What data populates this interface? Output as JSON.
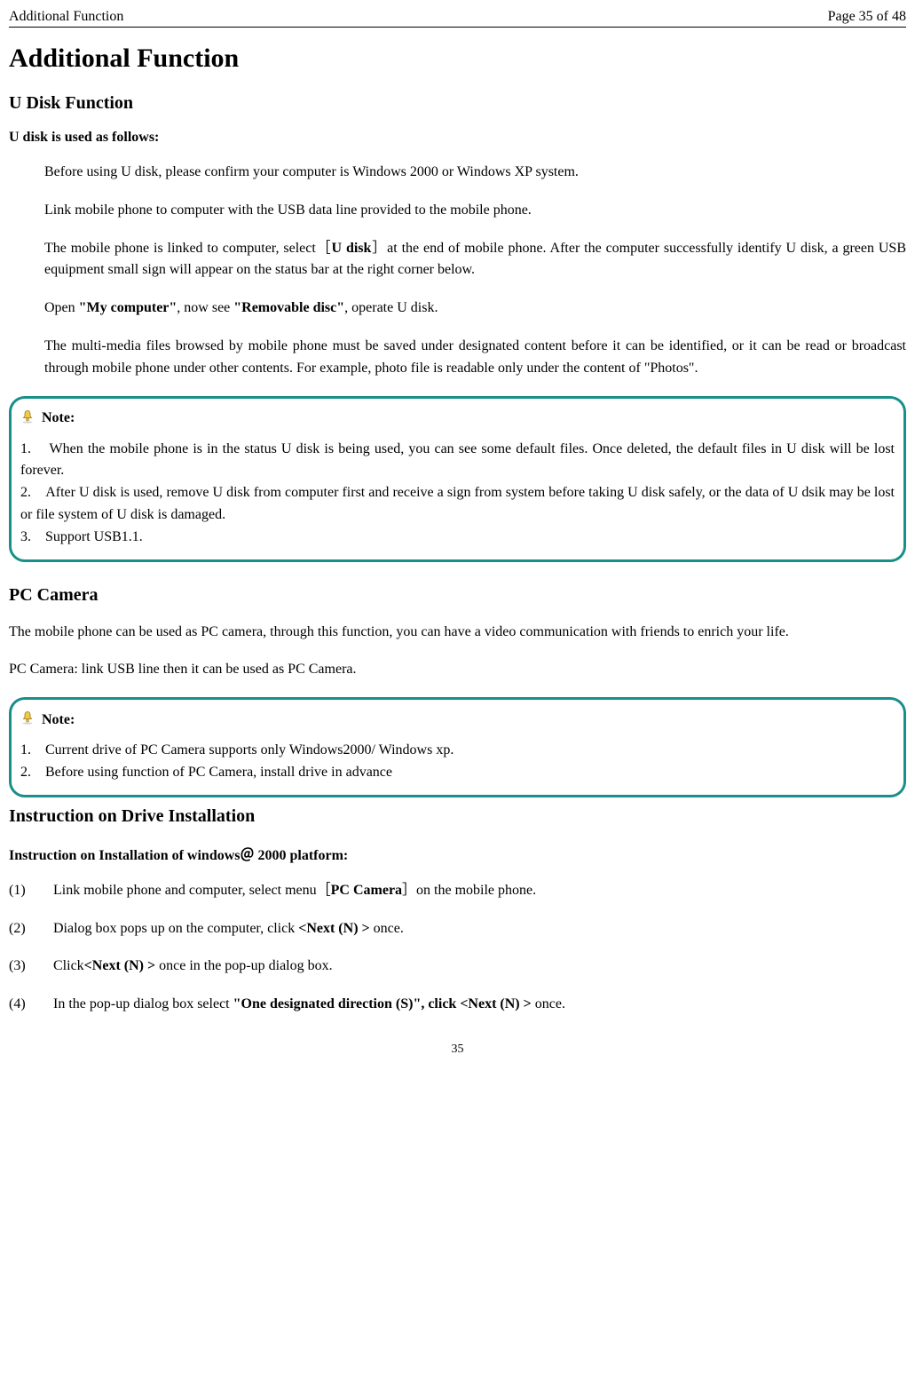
{
  "header": {
    "left": "Additional Function",
    "right": "Page 35 of 48"
  },
  "title": "Additional Function",
  "section_udisk": {
    "heading": "U Disk Function",
    "subheading": "U disk is used as follows:",
    "p1": "Before using U disk, please confirm your computer is Windows 2000 or Windows XP system.",
    "p2": "Link mobile phone to computer with the USB data line provided to the mobile phone.",
    "p3_a": "The mobile phone is linked to computer, select［",
    "p3_b": "U disk",
    "p3_c": "］at the end of mobile phone. After the computer successfully identify U disk, a green USB equipment small sign will appear on the status bar at the right corner below.",
    "p4_a": "Open ",
    "p4_b": "\"My computer\"",
    "p4_c": ", now see ",
    "p4_d": "\"Removable disc\"",
    "p4_e": ", operate U disk.",
    "p5": "The multi-media files browsed by mobile phone must be saved under designated content before it can be identified, or it can be read or broadcast through mobile phone under other contents. For example, photo file is readable only under the content of \"Photos\"."
  },
  "note1": {
    "label": "Note:",
    "n1_num": "1.",
    "n1": "When the mobile phone is in the status U disk is being used, you can see some default files. Once deleted, the default files in U disk will be lost forever.",
    "n2_num": "2.",
    "n2": "After U disk is used, remove U disk from computer first and receive a sign from system before taking U disk safely, or the data of U dsik may be lost or file system of U disk is damaged.",
    "n3_num": "3.",
    "n3": "Support USB1.1."
  },
  "section_pc": {
    "heading": "PC Camera",
    "p1": "The mobile phone can be used as PC camera, through this function, you can have a video communication with friends to enrich your life.",
    "p2": "PC Camera: link USB line then it can be used as PC Camera."
  },
  "note2": {
    "label": "Note:",
    "n1_num": "1.",
    "n1": "Current drive of PC Camera supports only Windows2000/ Windows xp.",
    "n2_num": "2.",
    "n2": "Before using function of PC Camera, install drive in advance"
  },
  "section_drive": {
    "heading": "Instruction on Drive Installation",
    "subheading": "Instruction on Installation of windows＠ 2000 platform:",
    "s1_num": "(1)",
    "s1_a": "Link mobile phone and computer, select menu［",
    "s1_b": "PC Camera",
    "s1_c": "］on the mobile phone.",
    "s2_num": "(2)",
    "s2_a": "Dialog box pops up on the computer, click ",
    "s2_b": "<Next (N) > ",
    "s2_c": "once.",
    "s3_num": "(3)",
    "s3_a": "Click",
    "s3_b": "<Next (N) > ",
    "s3_c": "once in the pop-up dialog box.",
    "s4_num": "(4)",
    "s4_a": "In the pop-up dialog box select ",
    "s4_b": "\"One designated direction (S)\", click <Next (N) > ",
    "s4_c": "once."
  },
  "footer": "35"
}
